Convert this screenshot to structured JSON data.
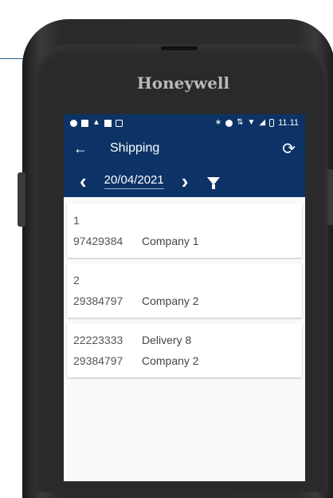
{
  "device": {
    "brand": "Honeywell"
  },
  "statusbar": {
    "left_icons": [
      "notification-icon",
      "gallery-icon",
      "android-icon",
      "square-icon",
      "calendar-icon"
    ],
    "right_icons": [
      "bluetooth-icon",
      "do-not-disturb-icon",
      "data-icon",
      "wifi-icon",
      "no-signal-icon",
      "battery-icon"
    ],
    "time": "11.11"
  },
  "appbar": {
    "title": "Shipping"
  },
  "datebar": {
    "date": "20/04/2021"
  },
  "colors": {
    "primary": "#0d3366",
    "background": "#fafafa"
  },
  "shipments": [
    {
      "line1_number": "1",
      "line1_text": "",
      "line2_number": "97429384",
      "line2_text": "Company 1"
    },
    {
      "line1_number": "2",
      "line1_text": "",
      "line2_number": "29384797",
      "line2_text": "Company 2"
    },
    {
      "line1_number": "22223333",
      "line1_text": "Delivery 8",
      "line2_number": "29384797",
      "line2_text": "Company 2"
    }
  ]
}
